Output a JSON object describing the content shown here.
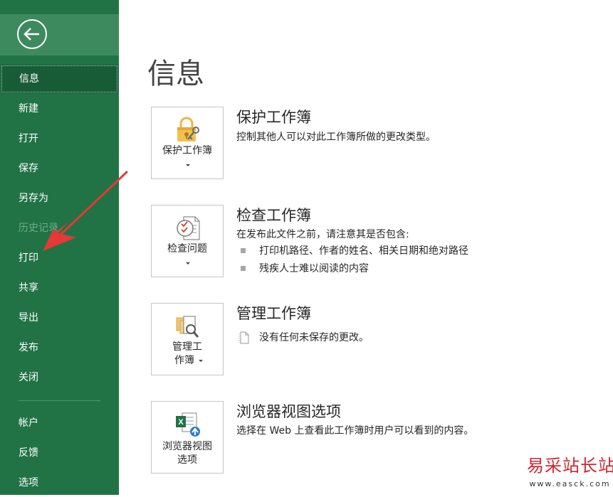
{
  "sidebar": {
    "items": [
      {
        "label": "信息",
        "selected": true
      },
      {
        "label": "新建"
      },
      {
        "label": "打开"
      },
      {
        "label": "保存"
      },
      {
        "label": "另存为"
      },
      {
        "label": "历史记录",
        "disabled": true
      },
      {
        "label": "打印"
      },
      {
        "label": "共享"
      },
      {
        "label": "导出"
      },
      {
        "label": "发布"
      },
      {
        "label": "关闭"
      },
      {
        "label": "帐户"
      },
      {
        "label": "反馈"
      },
      {
        "label": "选项"
      }
    ]
  },
  "main": {
    "title": "信息",
    "sections": [
      {
        "tile_label": "保护工作簿",
        "tile_icon": "lock-key-icon",
        "title": "保护工作簿",
        "description": "控制其他人可以对此工作簿所做的更改类型。"
      },
      {
        "tile_label": "检查问题",
        "tile_icon": "inspect-document-icon",
        "title": "检查工作簿",
        "description": "在发布此文件之前，请注意其是否包含:",
        "bullets": [
          "打印机路径、作者的姓名、相关日期和绝对路径",
          "残疾人士难以阅读的内容"
        ]
      },
      {
        "tile_label_line1": "管理工",
        "tile_label_line2": "作簿",
        "tile_icon": "manage-workbook-icon",
        "title": "管理工作簿",
        "description": "没有任何未保存的更改。"
      },
      {
        "tile_label_line1": "浏览器视图",
        "tile_label_line2": "选项",
        "tile_icon": "excel-web-icon",
        "title": "浏览器视图选项",
        "description": "选择在 Web 上查看此工作簿时用户可以看到的内容。"
      }
    ]
  },
  "watermark": {
    "main": "易采站长站",
    "sub": "www.easck.com"
  },
  "colors": {
    "sidebar": "#217346",
    "selected": "#185c37",
    "arrow": "#e53935"
  }
}
